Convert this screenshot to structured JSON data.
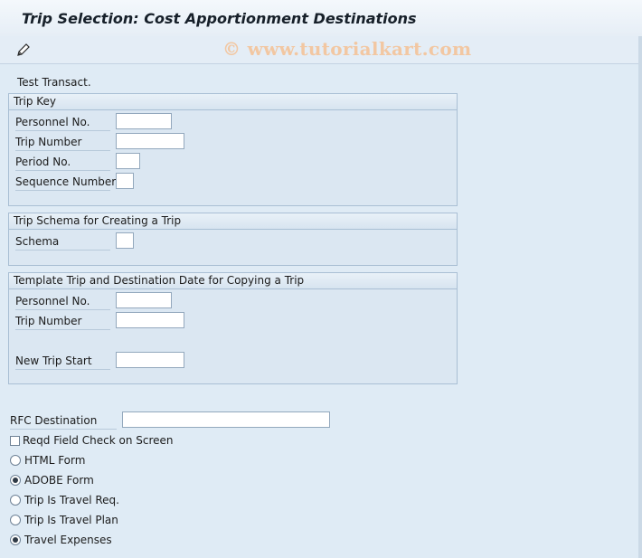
{
  "window": {
    "title": "Trip Selection: Cost Apportionment Destinations",
    "watermark": "© www.tutorialkart.com"
  },
  "toolbar": {
    "edit_icon": "pencil-icon"
  },
  "form": {
    "test_transaction_label": "Test Transact.",
    "trip_key": {
      "header": "Trip Key",
      "personnel_no_label": "Personnel No.",
      "trip_number_label": "Trip Number",
      "period_no_label": "Period No.",
      "sequence_number_label": "Sequence Number"
    },
    "trip_schema": {
      "header": "Trip Schema for Creating a Trip",
      "schema_label": "Schema"
    },
    "template": {
      "header": "Template Trip and Destination Date for Copying a Trip",
      "personnel_no_label": "Personnel No.",
      "trip_number_label": "Trip Number",
      "new_trip_start_label": "New Trip Start"
    },
    "rfc_destination_label": "RFC Destination",
    "reqd_field_check": {
      "label": "Reqd Field Check on Screen",
      "checked": false
    },
    "form_type": {
      "html_label": "HTML Form",
      "adobe_label": "ADOBE Form",
      "selected": "ADOBE Form"
    },
    "trip_type": {
      "travel_req_label": "Trip Is Travel Req.",
      "travel_plan_label": "Trip Is Travel Plan",
      "travel_expenses_label": "Travel Expenses",
      "selected": "Travel Expenses"
    }
  }
}
